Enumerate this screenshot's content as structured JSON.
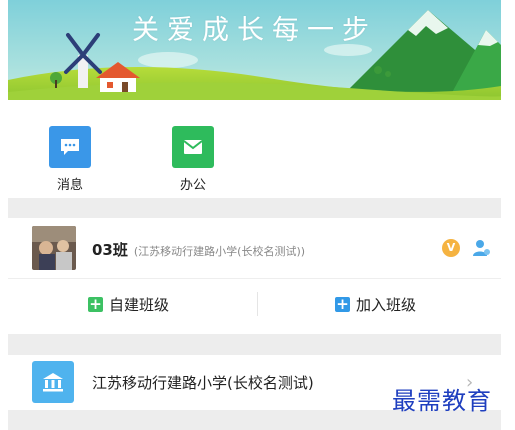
{
  "banner": {
    "slogan": "关爱成长每一步"
  },
  "quick_actions": [
    {
      "label": "消息",
      "icon": "message-icon",
      "color": "#3a97e8"
    },
    {
      "label": "办公",
      "icon": "office-mail-icon",
      "color": "#2ebb5c"
    }
  ],
  "class_item": {
    "name": "03班",
    "school": "(江苏移动行建路小学(长校名测试))",
    "badge": "V"
  },
  "actions": {
    "create_class": "自建班级",
    "join_class": "加入班级"
  },
  "school_item": {
    "name": "江苏移动行建路小学(长校名测试)"
  },
  "watermark": "最需教育",
  "colors": {
    "green": "#3cc163",
    "blue": "#3199e7",
    "separator": "#ededed",
    "vip": "#f5b341"
  }
}
